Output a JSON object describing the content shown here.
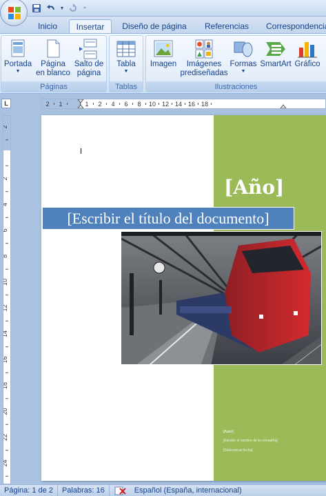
{
  "quick_access": {
    "save": "save-icon",
    "undo": "undo-icon",
    "redo": "redo-icon",
    "customize": "dropdown-arrow-icon"
  },
  "tabs": [
    {
      "label": "Inicio",
      "active": false
    },
    {
      "label": "Insertar",
      "active": true
    },
    {
      "label": "Diseño de página",
      "active": false
    },
    {
      "label": "Referencias",
      "active": false
    },
    {
      "label": "Correspondencia",
      "active": false
    }
  ],
  "ribbon": {
    "groups": [
      {
        "label": "Páginas"
      },
      {
        "label": "Tablas"
      },
      {
        "label": "Ilustraciones"
      }
    ],
    "buttons": {
      "portada": {
        "line1": "Portada",
        "line2": ""
      },
      "pagina_blanco": {
        "line1": "Página",
        "line2": "en blanco"
      },
      "salto_pagina": {
        "line1": "Salto de",
        "line2": "página"
      },
      "tabla": {
        "line1": "Tabla",
        "line2": ""
      },
      "imagen": {
        "line1": "Imagen",
        "line2": ""
      },
      "imagenes_pred": {
        "line1": "Imágenes",
        "line2": "prediseñadas"
      },
      "formas": {
        "line1": "Formas",
        "line2": ""
      },
      "smartart": {
        "line1": "SmartArt",
        "line2": ""
      },
      "grafico": {
        "line1": "Gráfico",
        "line2": ""
      }
    }
  },
  "ruler": {
    "corner_symbol": "L",
    "horizontal_ticks": [
      "2",
      "1",
      "",
      "1",
      "2",
      "4",
      "6",
      "8",
      "10",
      "12",
      "14",
      "16",
      "18"
    ],
    "vertical_ticks": [
      "2",
      "",
      "2",
      "4",
      "6",
      "8",
      "10",
      "12",
      "14",
      "16",
      "18",
      "20",
      "22",
      "24"
    ]
  },
  "document": {
    "year_placeholder": "[Año]",
    "title_placeholder": "[Escribir el título del documento]",
    "author_placeholder": "[Escribir el nombre de la compañía]",
    "date_placeholder": "[Seleccionar fecha]",
    "small_top": "[Autor]",
    "photo": "train-station-photo",
    "colors": {
      "green_bar": "#9bbb59",
      "title_box": "#4f81bd"
    }
  },
  "status": {
    "page": "Página: 1 de 2",
    "words": "Palabras: 16",
    "spell_icon": "spellcheck-error-icon",
    "language": "Español (España, internacional)"
  }
}
